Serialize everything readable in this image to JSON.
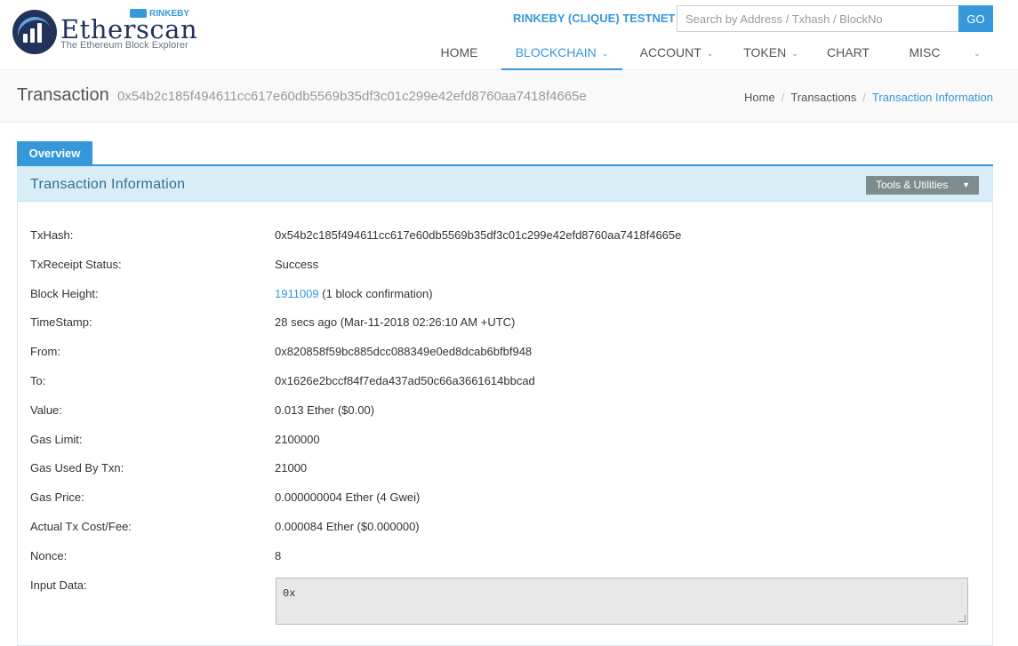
{
  "header": {
    "logo_badge": "RINKEBY",
    "logo_name": "Etherscan",
    "logo_tagline": "The Ethereum Block Explorer",
    "network_label": "RINKEBY (CLIQUE) TESTNET",
    "search_placeholder": "Search by Address / Txhash / BlockNo",
    "go_label": "GO",
    "brand_color": "#3498db"
  },
  "nav": {
    "items": [
      {
        "label": "HOME",
        "dropdown": false,
        "active": false
      },
      {
        "label": "BLOCKCHAIN",
        "dropdown": true,
        "active": true
      },
      {
        "label": "ACCOUNT",
        "dropdown": true,
        "active": false
      },
      {
        "label": "TOKEN",
        "dropdown": true,
        "active": false
      },
      {
        "label": "CHART",
        "dropdown": false,
        "active": false
      },
      {
        "label": "MISC",
        "dropdown": true,
        "active": false
      }
    ]
  },
  "title": {
    "label": "Transaction",
    "hash": "0x54b2c185f494611cc617e60db5569b35df3c01c299e42efd8760aa7418f4665e"
  },
  "breadcrumb": {
    "items": [
      "Home",
      "Transactions",
      "Transaction Information"
    ]
  },
  "tabs": {
    "overview": "Overview"
  },
  "panel": {
    "title": "Transaction Information",
    "tools_label": "Tools & Utilities"
  },
  "tx": {
    "txhash": {
      "label": "TxHash:",
      "value": "0x54b2c185f494611cc617e60db5569b35df3c01c299e42efd8760aa7418f4665e"
    },
    "status": {
      "label": "TxReceipt Status:",
      "value": "Success"
    },
    "block": {
      "label": "Block Height:",
      "value": "1911009",
      "suffix": " (1 block confirmation)"
    },
    "timestamp": {
      "label": "TimeStamp:",
      "value": "28 secs ago (Mar-11-2018 02:26:10 AM +UTC)"
    },
    "from": {
      "label": "From:",
      "value": "0x820858f59bc885dcc088349e0ed8dcab6bfbf948"
    },
    "to": {
      "label": "To:",
      "value": "0x1626e2bccf84f7eda437ad50c66a3661614bbcad"
    },
    "value": {
      "label": "Value:",
      "value": "0.013 Ether ($0.00)"
    },
    "gas_limit": {
      "label": "Gas Limit:",
      "value": "2100000"
    },
    "gas_used": {
      "label": "Gas Used By Txn:",
      "value": "21000"
    },
    "gas_price": {
      "label": "Gas Price:",
      "value": "0.000000004 Ether (4 Gwei)"
    },
    "fee": {
      "label": "Actual Tx Cost/Fee:",
      "value": "0.000084 Ether ($0.000000)"
    },
    "nonce": {
      "label": "Nonce:",
      "value": "8"
    },
    "input_data": {
      "label": "Input Data:",
      "value": "0x"
    }
  }
}
